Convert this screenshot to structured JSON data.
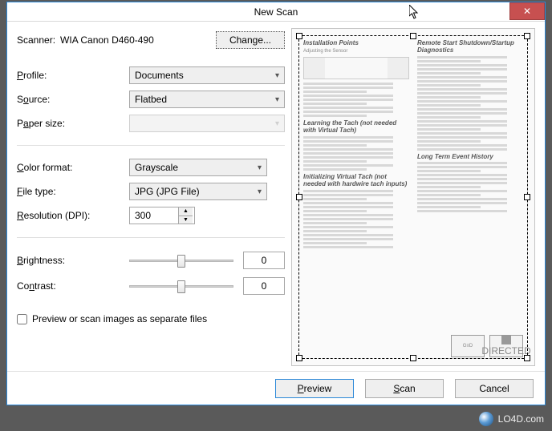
{
  "window": {
    "title": "New Scan"
  },
  "scanner": {
    "label": "Scanner:",
    "name": "WIA Canon D460-490",
    "change_label": "Change..."
  },
  "fields": {
    "profile": {
      "label": "Profile:",
      "value": "Documents"
    },
    "source": {
      "label": "Source:",
      "value": "Flatbed"
    },
    "paper_size": {
      "label": "Paper size:",
      "value": ""
    },
    "color_format": {
      "label": "Color format:",
      "value": "Grayscale"
    },
    "file_type": {
      "label": "File type:",
      "value": "JPG (JPG File)"
    },
    "resolution": {
      "label": "Resolution (DPI):",
      "value": "300"
    },
    "brightness": {
      "label": "Brightness:",
      "value": "0"
    },
    "contrast": {
      "label": "Contrast:",
      "value": "0"
    }
  },
  "checkbox": {
    "separate_files": "Preview or scan images as separate files",
    "checked": false
  },
  "footer": {
    "preview": "Preview",
    "scan": "Scan",
    "cancel": "Cancel"
  },
  "preview_doc": {
    "h1": "Installation Points",
    "h1b": "Remote Start Shutdown/Startup Diagnostics",
    "s1": "Adjusting the Sensor",
    "s2": "Learning the Tach (not needed with Virtual Tach)",
    "s3": "Initializing Virtual Tach (not needed with hardwire tach inputs)",
    "s4": "Long Term Event History",
    "brand": "DIRECTED"
  },
  "watermark": {
    "text": "LO4D.com"
  }
}
